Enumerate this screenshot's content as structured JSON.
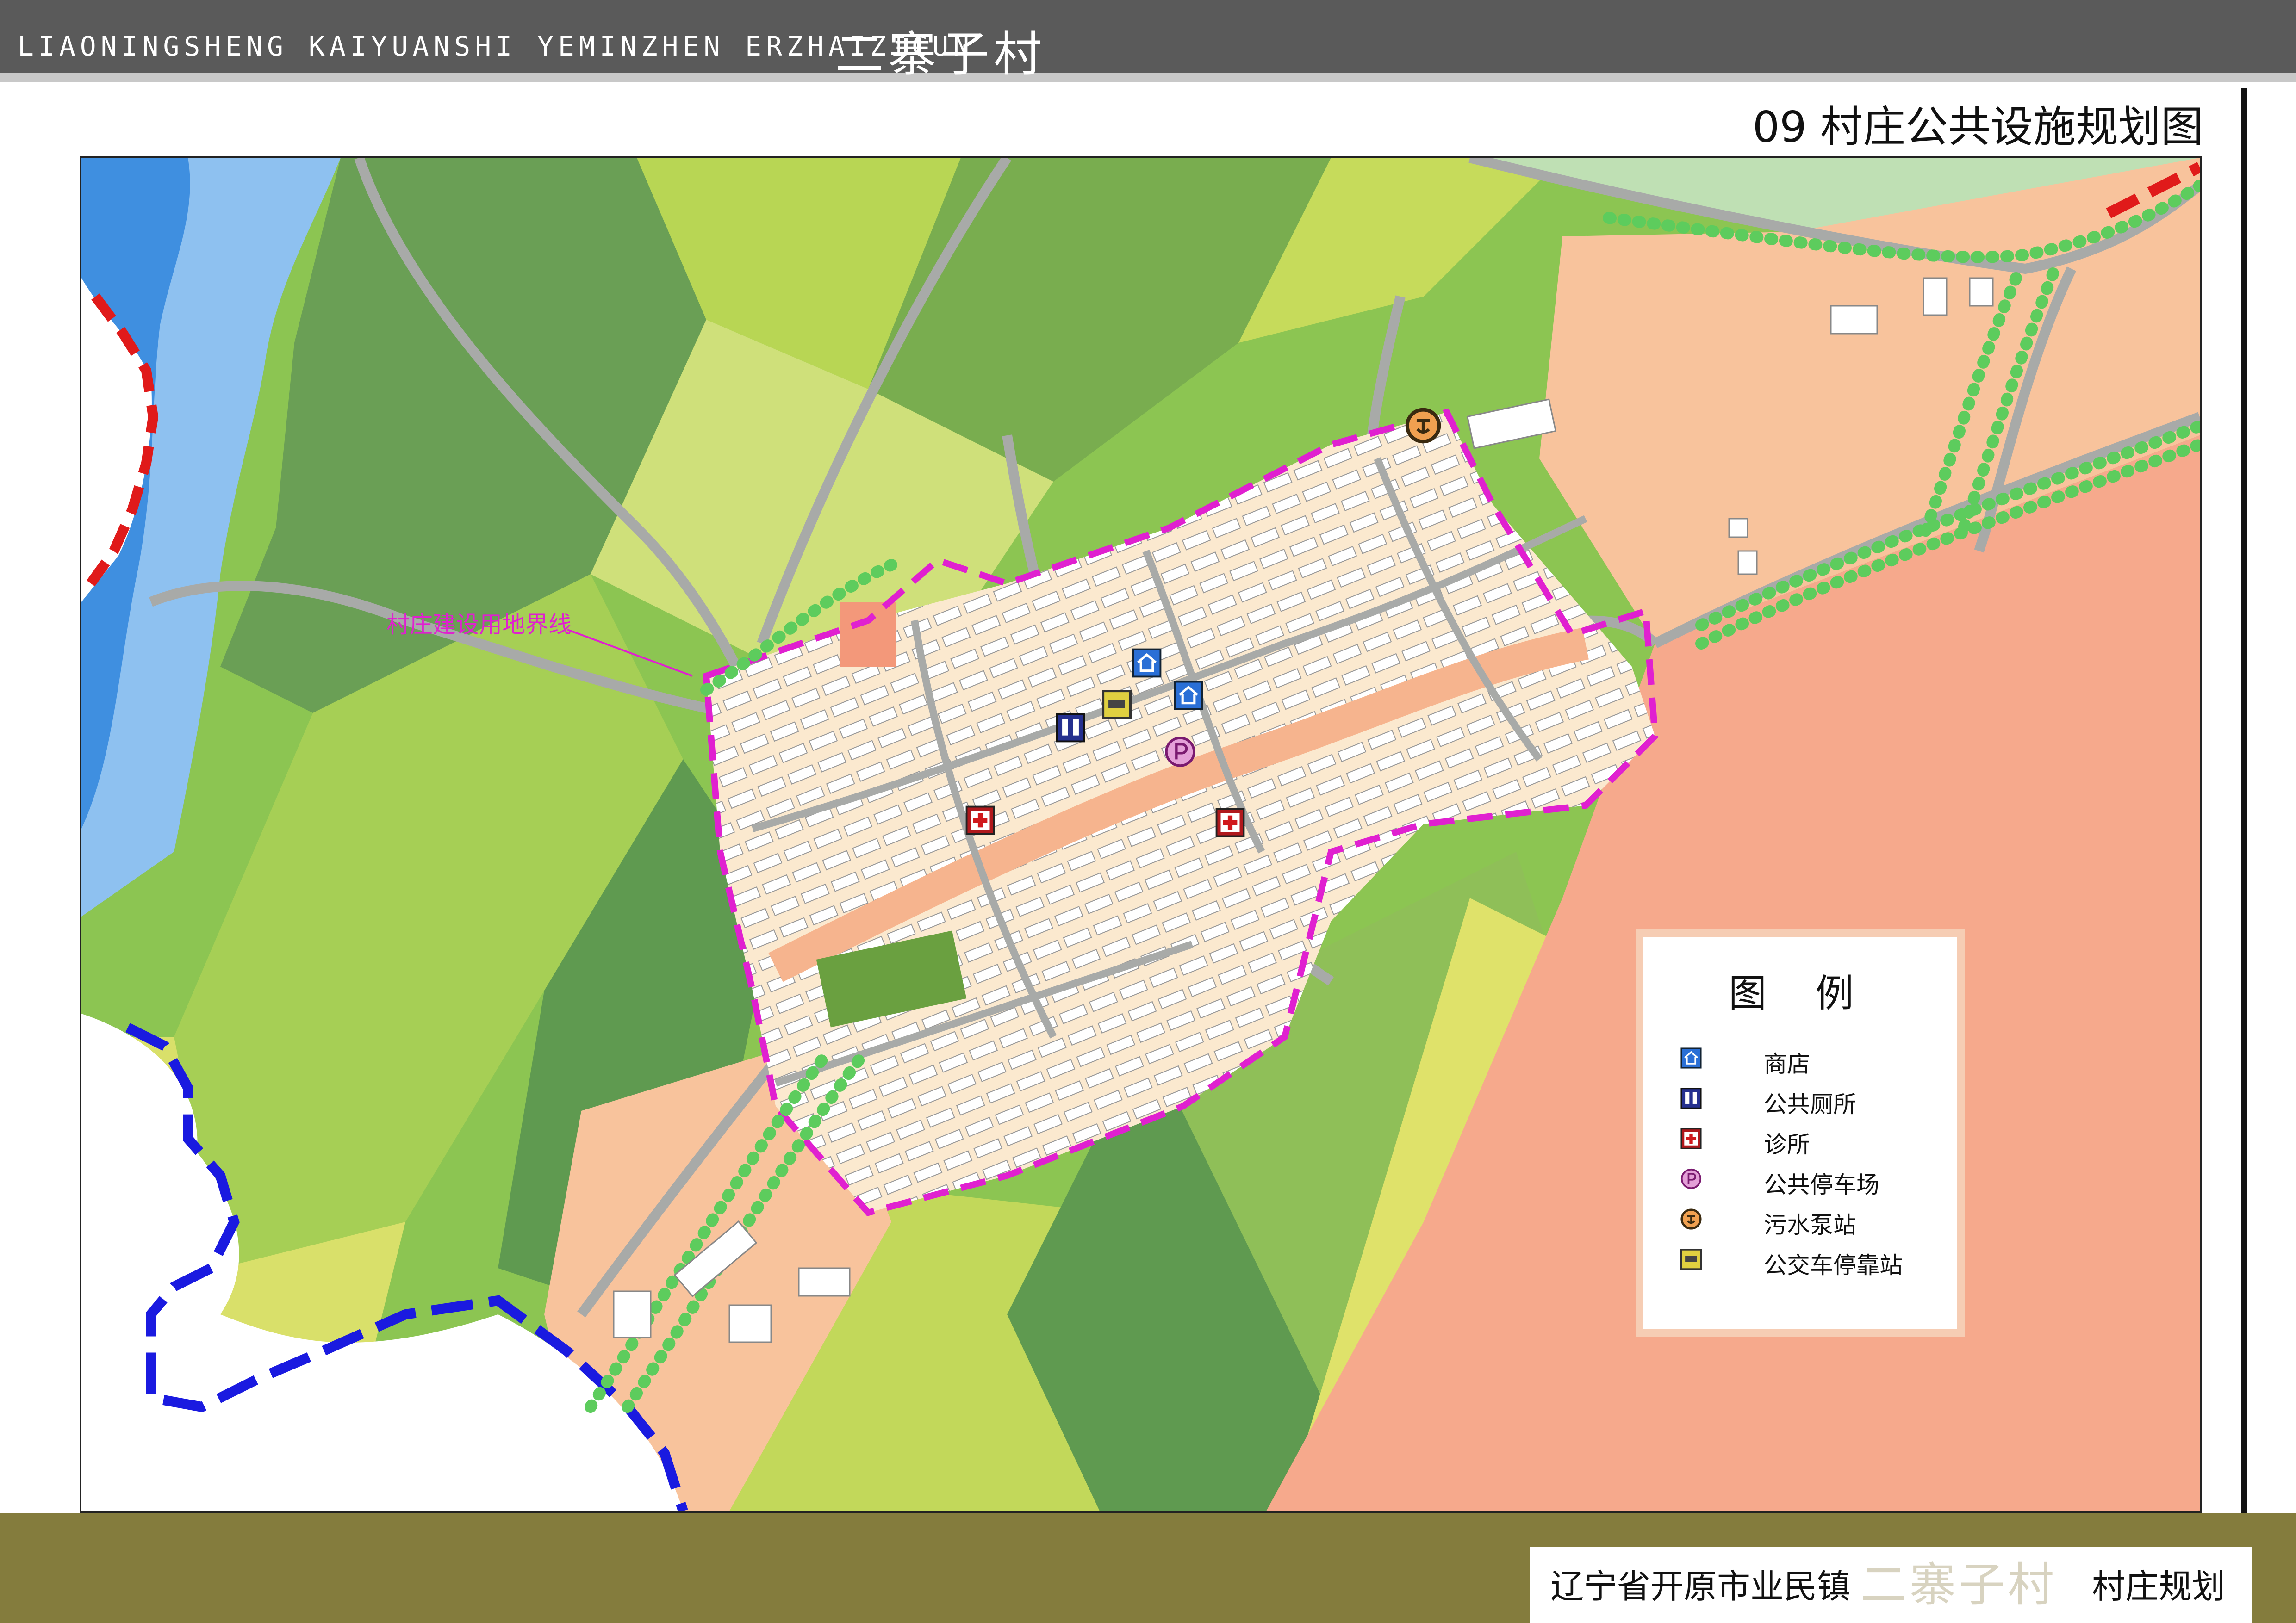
{
  "header": {
    "latin_title": "LIAONINGSHENG KAIYUANSHI YEMINZHEN ERZHAIZICUN",
    "chinese_title": "二寨子村",
    "sheet_title": "09 村庄公共设施规划图"
  },
  "map": {
    "boundary_label": "村庄建设用地界线",
    "colors": {
      "river": "#3f8fe0",
      "river_light": "#8ec1f0",
      "farmland_dark": "#5f9a50",
      "farmland_mid": "#8cc552",
      "farmland_light": "#c9dc5a",
      "farmland_yellow": "#dfe26a",
      "industrial": "#f6a98c",
      "development": "#f8c39c",
      "village_land": "#fbe6c8",
      "road": "#a8aaa8",
      "boundary": "#e020d0",
      "admin_boundary_blue": "#1a1ae0",
      "admin_boundary_red": "#e01a1a",
      "tree_green": "#5dcc5d"
    },
    "facility_markers": [
      {
        "type": "shop",
        "icon": "shop-icon"
      },
      {
        "type": "shop",
        "icon": "shop-icon"
      },
      {
        "type": "toilet",
        "icon": "toilet-icon"
      },
      {
        "type": "bus_stop",
        "icon": "bus-stop-icon"
      },
      {
        "type": "parking",
        "icon": "parking-icon"
      },
      {
        "type": "clinic",
        "icon": "clinic-icon"
      },
      {
        "type": "clinic",
        "icon": "clinic-icon"
      },
      {
        "type": "pump_station",
        "icon": "pump-station-icon"
      }
    ]
  },
  "legend": {
    "title": "图 例",
    "items": [
      {
        "label": "商店",
        "icon": "shop-icon"
      },
      {
        "label": "公共厕所",
        "icon": "toilet-icon"
      },
      {
        "label": "诊所",
        "icon": "clinic-icon"
      },
      {
        "label": "公共停车场",
        "icon": "parking-icon"
      },
      {
        "label": "污水泵站",
        "icon": "pump-station-icon"
      },
      {
        "label": "公交车停靠站",
        "icon": "bus-stop-icon"
      }
    ]
  },
  "footer": {
    "prefix": "辽宁省开原市业民镇",
    "village": "二寨子村",
    "suffix": "村庄规划"
  }
}
